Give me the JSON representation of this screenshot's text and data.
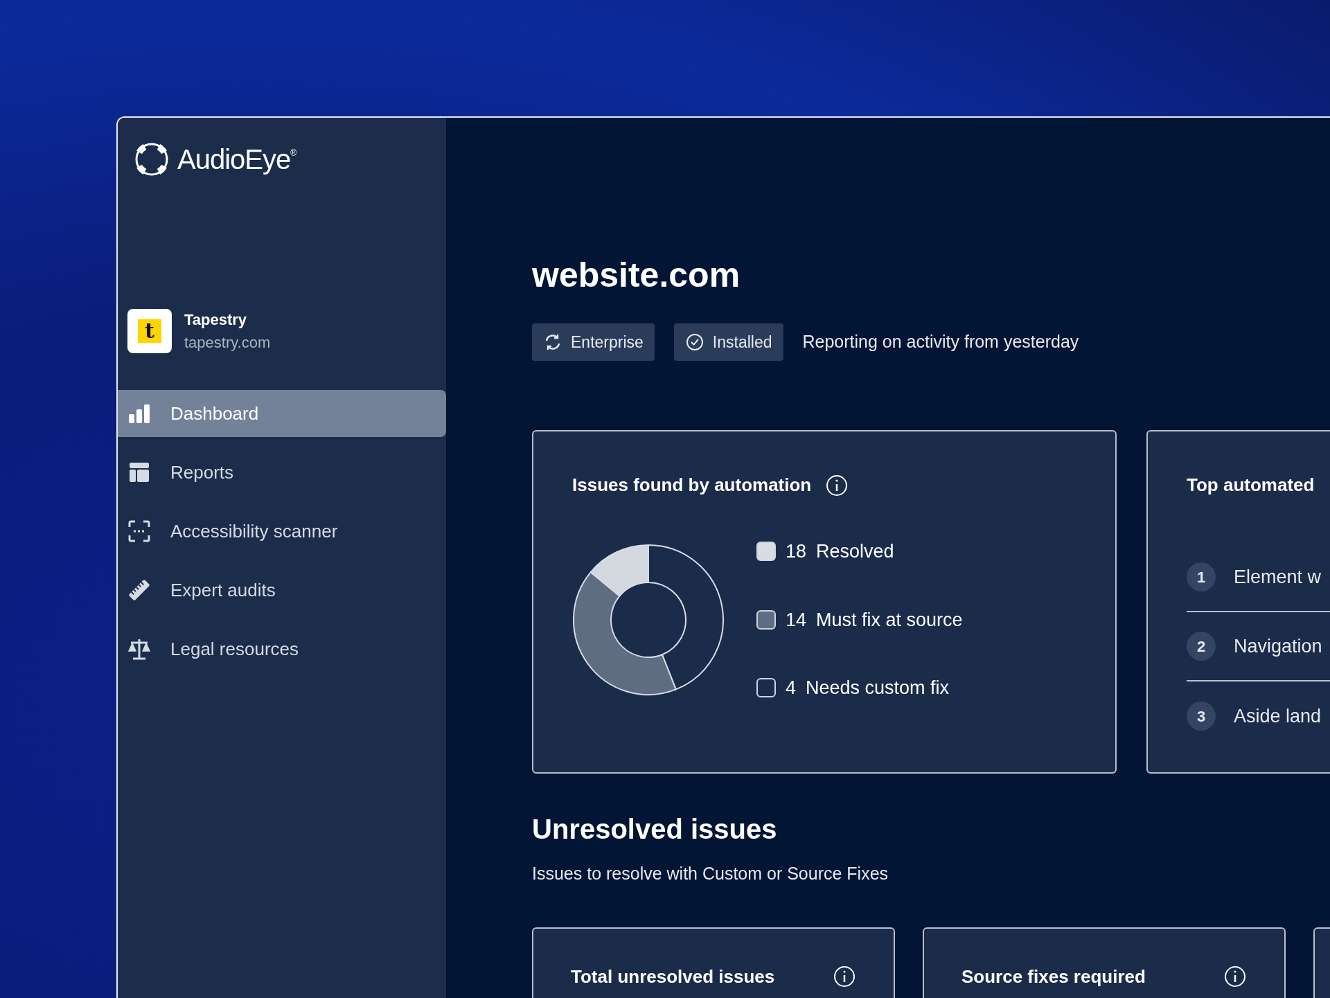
{
  "sidebar": {
    "brand": "AudioEye$^{®}$",
    "account": {
      "initial": "t",
      "name": "Tapestry",
      "domain": "tapestry.com"
    },
    "items": [
      {
        "label": "Dashboard",
        "selected": true
      },
      {
        "label": "Reports",
        "selected": false
      },
      {
        "label": "Accessibility scanner",
        "selected": false
      },
      {
        "label": "Expert audits",
        "selected": false
      },
      {
        "label": "Legal resources",
        "selected": false
      }
    ]
  },
  "header": {
    "title": "website.com",
    "badges": [
      {
        "label": "Enterprise"
      },
      {
        "label": "Installed"
      }
    ],
    "note": "Reporting on activity from yesterday"
  },
  "issues_card": {
    "title": "Issues found by automation",
    "chart_data": {
      "type": "donut",
      "values": [
        44,
        42,
        14
      ],
      "colors": [
        "#1b2b4a",
        "#5f6d83",
        "#d3d7de"
      ]
    },
    "legend": [
      {
        "count": "18",
        "label": "Resolved",
        "kind": "filled",
        "color": "#d9dce2"
      },
      {
        "count": "14",
        "label": "Must fix at source",
        "kind": "filled",
        "color": "#5f6d83"
      },
      {
        "count": "4",
        "label": "Needs custom fix",
        "kind": "outline"
      }
    ]
  },
  "top_card": {
    "title": "Top automated",
    "items": [
      {
        "number": "1",
        "text": "Element w"
      },
      {
        "number": "2",
        "text": "Navigation"
      },
      {
        "number": "3",
        "text": "Aside land"
      }
    ]
  },
  "unresolved": {
    "title": "Unresolved issues",
    "subtitle": "Issues to resolve with Custom or Source Fixes",
    "cards": [
      {
        "title": "Total unresolved issues",
        "info": true
      },
      {
        "title": "Source fixes required",
        "info": true
      },
      {
        "info": false
      }
    ]
  }
}
